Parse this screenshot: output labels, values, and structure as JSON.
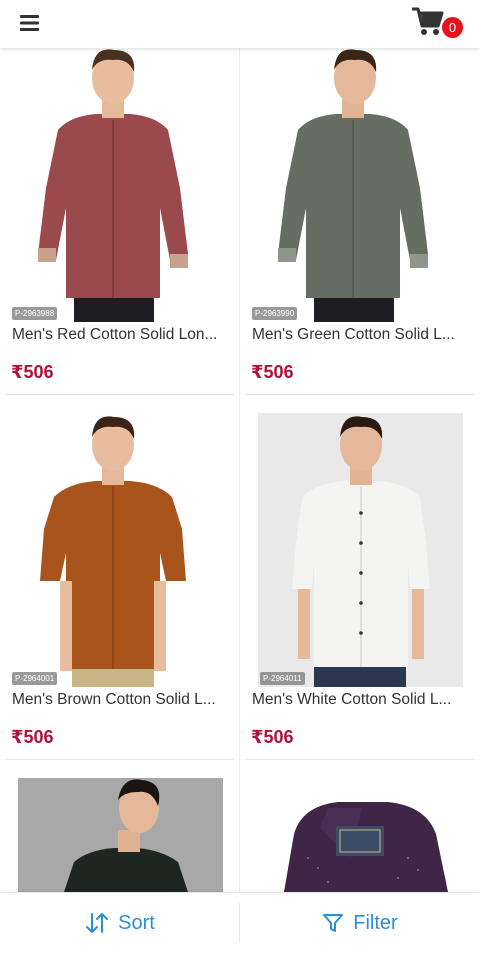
{
  "header": {
    "menu_icon": "hamburger-menu-icon",
    "cart_icon": "shopping-cart-icon",
    "cart_count": "0",
    "cart_badge_color": "#e8101a"
  },
  "products": [
    {
      "code": "P-2963988",
      "name": "Men's Red Cotton Solid Lon...",
      "price": "₹506",
      "shirt_color": "#9a4a4c"
    },
    {
      "code": "P-2963990",
      "name": "Men's Green Cotton Solid L...",
      "price": "₹506",
      "shirt_color": "#666d62"
    },
    {
      "code": "P-2964001",
      "name": "Men's Brown Cotton Solid L...",
      "price": "₹506",
      "shirt_color": "#a8541c"
    },
    {
      "code": "P-2964011",
      "name": "Men's White Cotton Solid L...",
      "price": "₹506",
      "shirt_color": "#f4f4f2"
    },
    {
      "shirt_color": "#1e2622"
    },
    {
      "shirt_color": "#3f2646"
    }
  ],
  "bottom_bar": {
    "sort_label": "Sort",
    "sort_icon": "sort-arrows-icon",
    "filter_label": "Filter",
    "filter_icon": "filter-funnel-icon",
    "accent_color": "#2b8fd6"
  },
  "colors": {
    "price": "#b0123a"
  }
}
